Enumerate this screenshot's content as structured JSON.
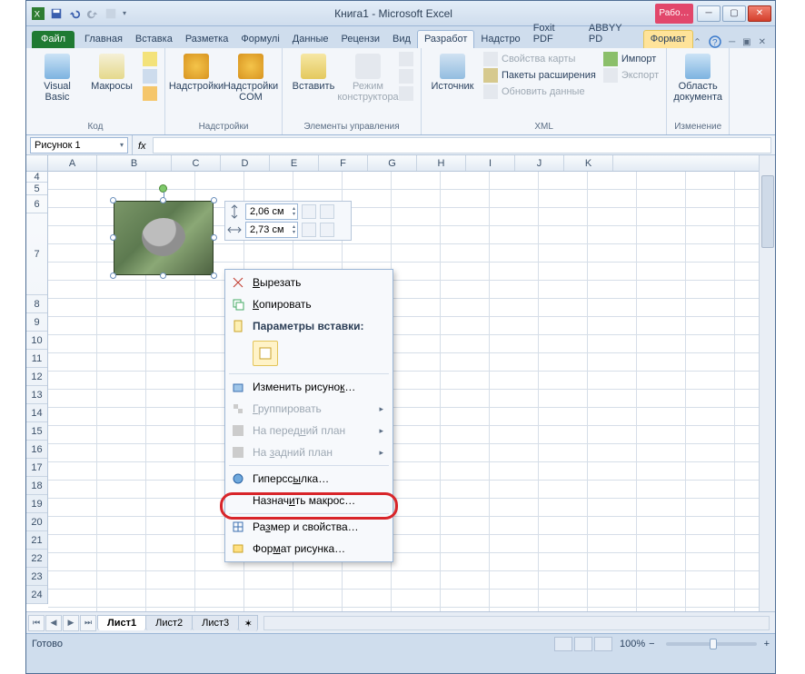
{
  "title": "Книга1  -  Microsoft Excel",
  "rabo_truncated": "Рабо…",
  "file_tab": "Файл",
  "tabs": [
    "Главная",
    "Вставка",
    "Разметка",
    "Формулі",
    "Данные",
    "Рецензи",
    "Вид",
    "Разработ",
    "Надстро",
    "Foxit PDF",
    "ABBYY PD",
    "Формат"
  ],
  "active_tab_index": 7,
  "format_tab_index": 11,
  "ribbon": {
    "code": {
      "vb": "Visual\nBasic",
      "macros": "Макросы",
      "label": "Код"
    },
    "addins": {
      "addin": "Надстройки",
      "com": "Надстройки\nCOM",
      "label": "Надстройки"
    },
    "controls": {
      "insert": "Вставить",
      "design": "Режим\nконструктора",
      "label": "Элементы управления"
    },
    "xml": {
      "source": "Источник",
      "props": "Свойства карты",
      "packets": "Пакеты расширения",
      "refresh": "Обновить данные",
      "import": "Импорт",
      "export": "Экспорт",
      "label": "XML"
    },
    "docarea": {
      "btn": "Область\nдокумента",
      "label": "Изменение"
    }
  },
  "namebox": "Рисунок 1",
  "columns": [
    "A",
    "B",
    "C",
    "D",
    "E",
    "F",
    "G",
    "H",
    "I",
    "J",
    "K"
  ],
  "row_start": 4,
  "row_end": 24,
  "mini": {
    "height": "2,06 см",
    "width": "2,73 см"
  },
  "ctx": {
    "cut": "Вырезать",
    "copy": "Копировать",
    "paste_title": "Параметры вставки:",
    "change_pic": "Изменить рисунок…",
    "group": "Группировать",
    "front": "На передний план",
    "back": "На задний план",
    "hyperlink": "Гиперссылка…",
    "assign_macro": "Назначить макрос…",
    "size_props": "Размер и свойства…",
    "format_pic": "Формат рисунка…"
  },
  "sheets": [
    "Лист1",
    "Лист2",
    "Лист3"
  ],
  "active_sheet": 0,
  "status": "Готово",
  "zoom": "100%"
}
